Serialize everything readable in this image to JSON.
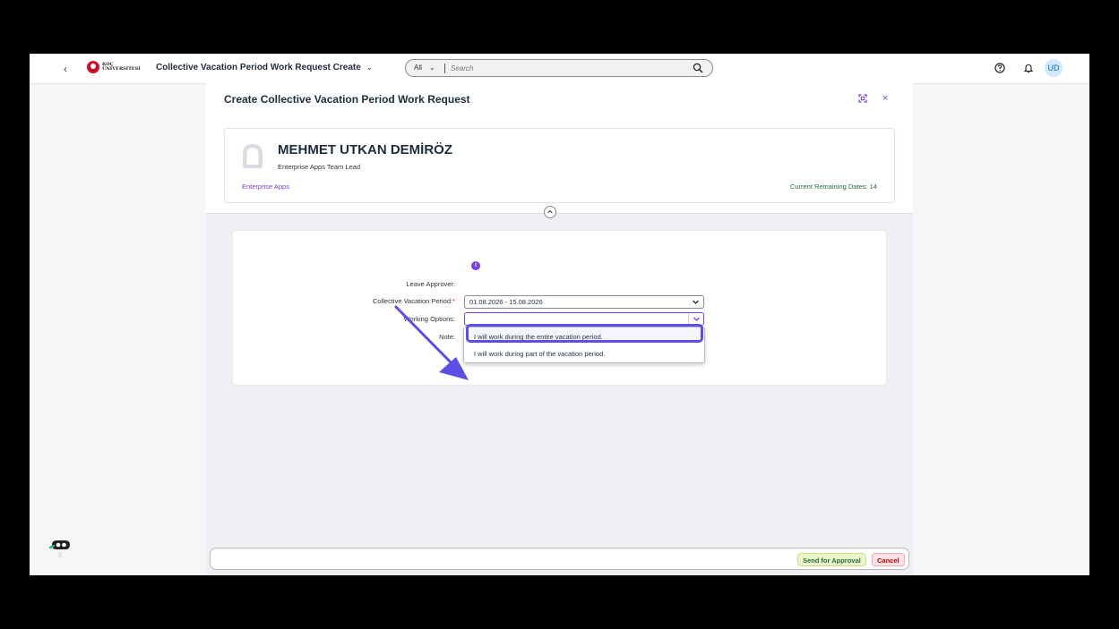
{
  "shell": {
    "back_glyph": "‹",
    "logo_line1": "KOÇ",
    "logo_line2": "ÜNİVERSİTESİ",
    "app_title": "Collective Vacation Period Work Request Create",
    "app_title_chevron": "⌄",
    "search_scope": "All",
    "search_scope_chevron": "⌄",
    "search_placeholder": "Search",
    "avatar_initials": "UD",
    "icons": [
      "back-icon",
      "koc-logo",
      "search-icon",
      "help-icon",
      "bell-icon"
    ]
  },
  "page": {
    "title": "Create Collective Vacation Period Work Request",
    "close_glyph": "×"
  },
  "employee": {
    "name": "MEHMET UTKAN DEMİRÖZ",
    "role": "Enterprise Apps Team Lead",
    "department": "Enterprise Apps",
    "remaining": "Current Remaining Dates: 14"
  },
  "form": {
    "info_glyph": "i",
    "leave_approver_label": "Leave Approver:",
    "collective_period_label": "Collective Vacation Period:",
    "collective_period_value": "01.08.2026 - 15.08.2026",
    "working_options_label": "Working Options:",
    "working_options_value": "",
    "note_label": "Note:",
    "working_options_list": [
      "I will work during the entire vacation period.",
      "I will work during part of the vacation period."
    ],
    "highlighted_option_index": 0
  },
  "footer": {
    "send_label": "Send for Approval",
    "cancel_label": "Cancel"
  },
  "colors": {
    "accent": "#7b3fe4",
    "annotation": "#5b4fe6",
    "send_bg": "#ebf5cb",
    "cancel_bg": "#fde3e6",
    "brand_red": "#c8102e"
  }
}
